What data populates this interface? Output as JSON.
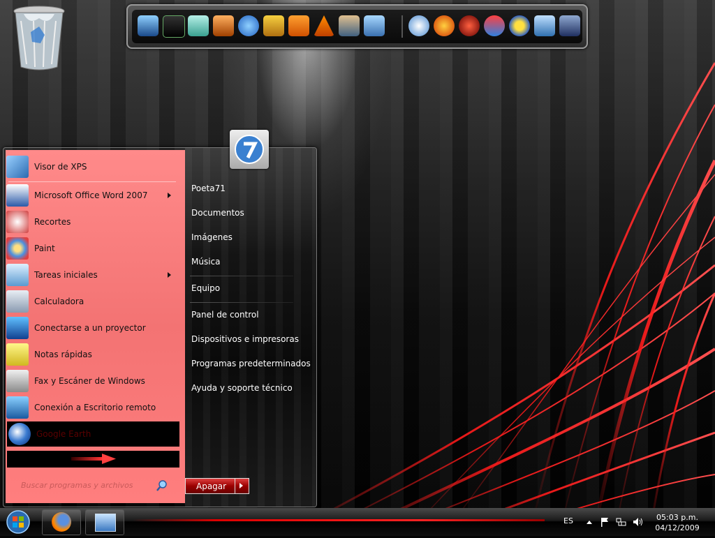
{
  "start_menu": {
    "programs": [
      {
        "label": "Visor de XPS",
        "icon": "xps-viewer-icon",
        "submenu": false
      },
      {
        "label": "Microsoft Office Word 2007",
        "icon": "word-icon",
        "submenu": true
      },
      {
        "label": "Recortes",
        "icon": "snipping-tool-icon",
        "submenu": false
      },
      {
        "label": "Paint",
        "icon": "paint-icon",
        "submenu": false
      },
      {
        "label": "Tareas iniciales",
        "icon": "getting-started-icon",
        "submenu": true
      },
      {
        "label": "Calculadora",
        "icon": "calculator-icon",
        "submenu": false
      },
      {
        "label": "Conectarse a un proyector",
        "icon": "projector-icon",
        "submenu": false
      },
      {
        "label": "Notas rápidas",
        "icon": "sticky-notes-icon",
        "submenu": false
      },
      {
        "label": "Fax y Escáner de Windows",
        "icon": "fax-scanner-icon",
        "submenu": false
      },
      {
        "label": "Conexión a Escritorio remoto",
        "icon": "remote-desktop-icon",
        "submenu": false
      }
    ],
    "highlighted_program": {
      "label": "Google Earth",
      "icon": "google-earth-icon"
    },
    "search_placeholder": "Buscar programas y archivos",
    "right_links": [
      "Poeta71",
      "Documentos",
      "Imágenes",
      "Música",
      "Equipo",
      "Panel de control",
      "Dispositivos e impresoras",
      "Programas predeterminados",
      "Ayuda y soporte técnico"
    ],
    "shutdown_label": "Apagar"
  },
  "taskbar": {
    "language": "ES",
    "time": "05:03 p.m.",
    "date": "04/12/2009"
  },
  "dock_icons": [
    "monitor-icon",
    "system-monitor-icon",
    "glass-icon",
    "photo-icon",
    "ie-icon",
    "gadget-icon",
    "media-player-icon",
    "vlc-icon",
    "users-icon",
    "fridge-icon",
    "globe-icon",
    "firefox-alt-icon",
    "atube-catcher-icon",
    "paint-tool-icon",
    "star-icon",
    "virtualbox-icon",
    "network-icon"
  ],
  "colors": {
    "start_menu_left": "#f37373",
    "accent_red": "#d00000"
  }
}
